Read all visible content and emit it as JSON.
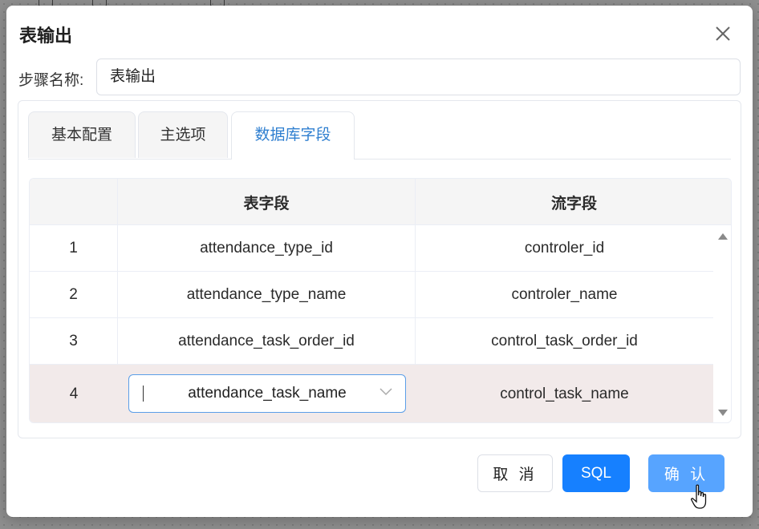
{
  "dialog": {
    "title": "表输出",
    "close_icon": "close-icon"
  },
  "step_name": {
    "label": "步骤名称:",
    "value": "表输出"
  },
  "tabs": [
    {
      "label": "基本配置",
      "active": false
    },
    {
      "label": "主选项",
      "active": false
    },
    {
      "label": "数据库字段",
      "active": true
    }
  ],
  "table": {
    "headers": [
      "",
      "表字段",
      "流字段"
    ],
    "rows": [
      {
        "index": "1",
        "table_field": "attendance_type_id",
        "stream_field": "controler_id"
      },
      {
        "index": "2",
        "table_field": "attendance_type_name",
        "stream_field": "controler_name"
      },
      {
        "index": "3",
        "table_field": "attendance_task_order_id",
        "stream_field": "control_task_order_id"
      },
      {
        "index": "4",
        "table_field": "attendance_task_name",
        "stream_field": "control_task_name",
        "selected": true
      }
    ]
  },
  "buttons": {
    "cancel": "取 消",
    "sql": "SQL",
    "confirm": "确 认"
  },
  "colors": {
    "primary": "#1680ff",
    "primary_light": "#57a4ff",
    "active_tab_text": "#2f7fd0",
    "selected_row": "#f2eaea"
  }
}
